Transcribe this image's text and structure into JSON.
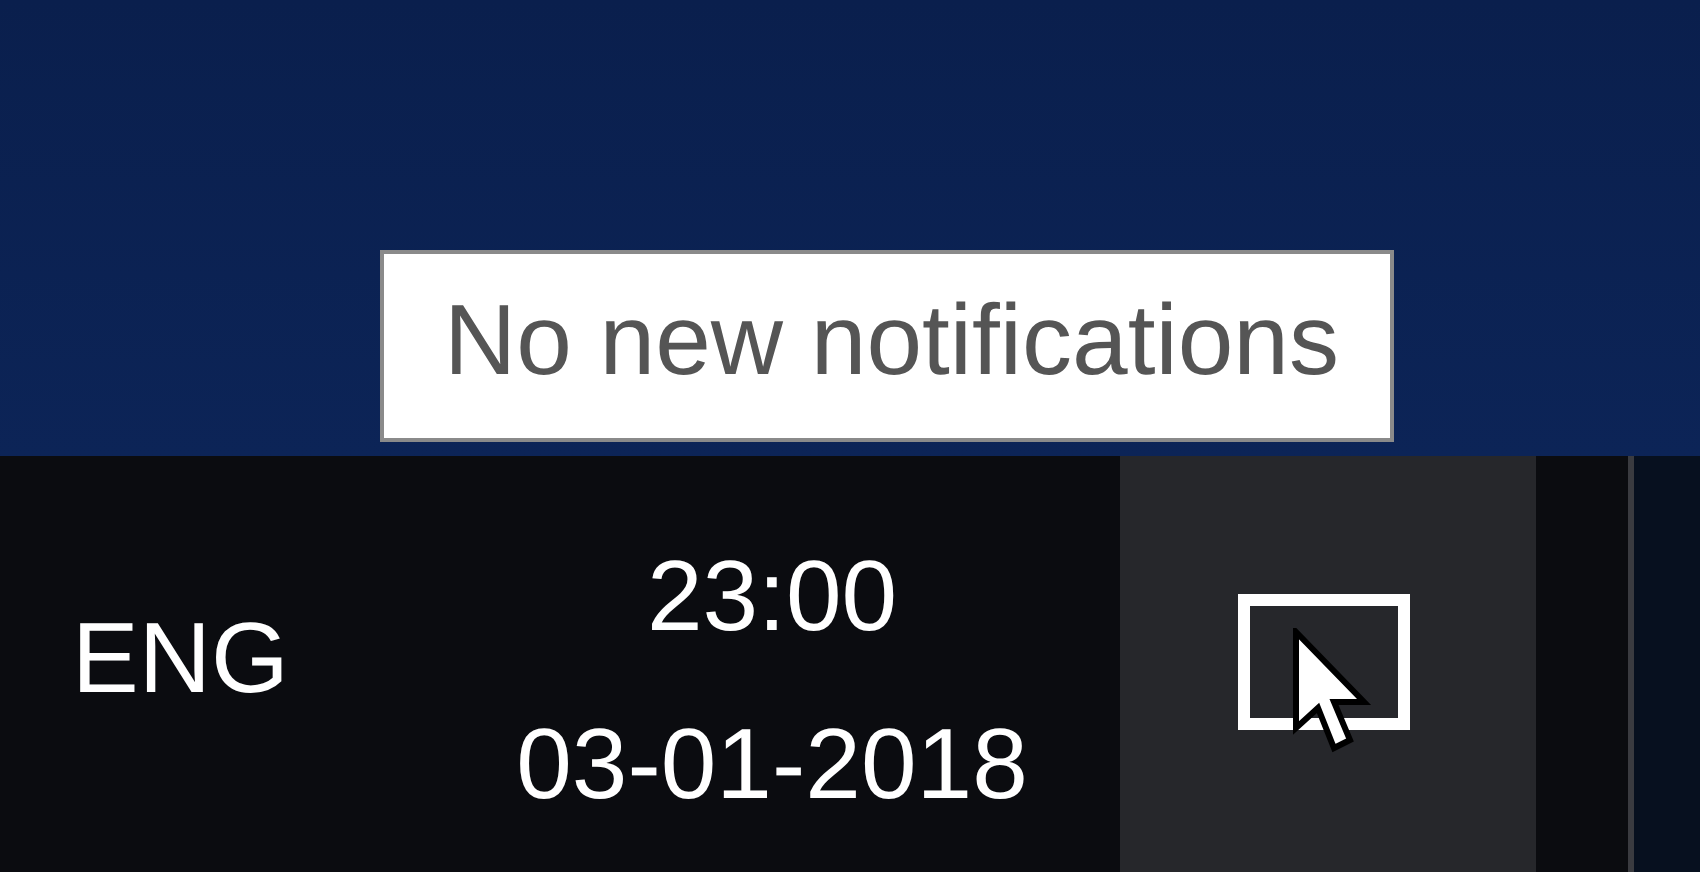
{
  "tooltip": {
    "text": "No new notifications"
  },
  "taskbar": {
    "language": "ENG",
    "time": "23:00",
    "date": "03-01-2018",
    "notification_button": {
      "hovered": true
    }
  }
}
